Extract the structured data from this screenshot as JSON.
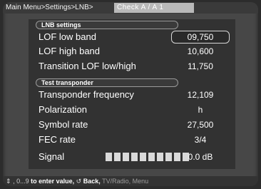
{
  "breadcrumb": {
    "path": "Main Menu>Settings>LNB>",
    "current": "Check A / A   1"
  },
  "lnb_section": {
    "header": "LNB settings",
    "rows": [
      {
        "label": "LOF low band",
        "value": "09,750"
      },
      {
        "label": "LOF high band",
        "value": "10,600"
      },
      {
        "label": "Transition LOF low/high",
        "value": "11,750"
      }
    ]
  },
  "transponder_section": {
    "header": "Test transponder",
    "rows": [
      {
        "label": "Transponder frequency",
        "value": "12,109"
      },
      {
        "label": "Polarization",
        "value": "h"
      },
      {
        "label": "Symbol rate",
        "value": "27,500"
      },
      {
        "label": "FEC rate",
        "value": "3/4"
      }
    ]
  },
  "signal": {
    "label": "Signal",
    "value": "0.0 dB",
    "level": 0.0
  },
  "help_bar": {
    "arrows_icon": "up-down-arrows-icon",
    "digits_text": ", 0...9",
    "enter_text": "to enter value,",
    "back_icon": "back-arrow-icon",
    "back_text": "Back,",
    "tvradio_text": "TV/Radio,",
    "menu_text": "Menu"
  }
}
